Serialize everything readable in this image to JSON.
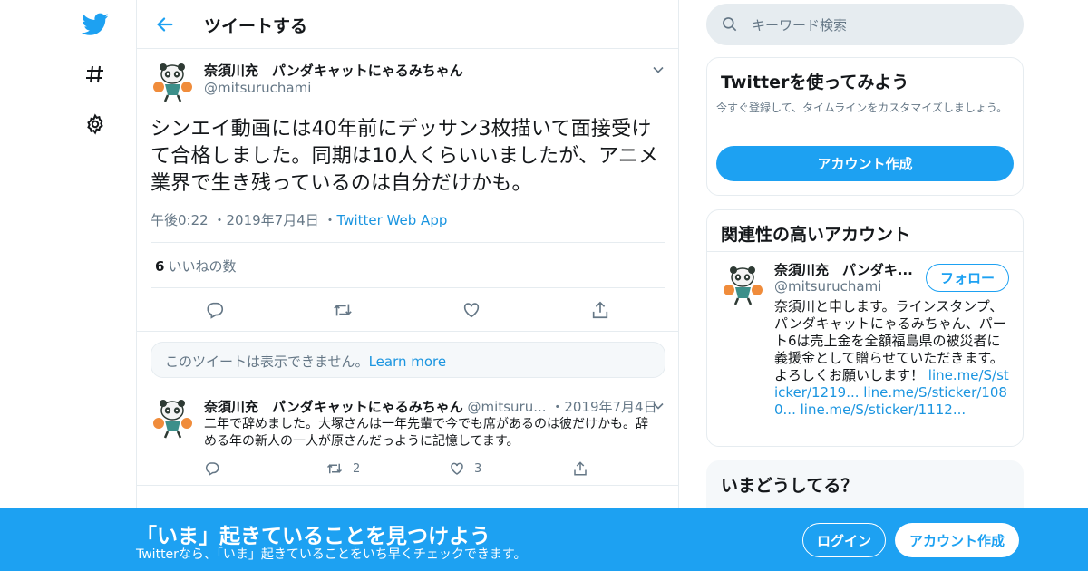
{
  "nav": {
    "icons": [
      "twitter-bird-icon",
      "hashtag-icon",
      "gear-icon"
    ]
  },
  "main": {
    "title": "ツイートする",
    "tweet": {
      "display_name": "奈須川充　パンダキャットにゃるみちゃん",
      "handle": "@mitsuruchami",
      "text": "シンエイ動画には40年前にデッサン3枚描いて面接受けて合格しました。同期は10人くらいいましたが、アニメ業界で生き残っているのは自分だけかも。",
      "time": "午後0:22",
      "date": "2019年7月4日",
      "source": "Twitter Web App",
      "likes_count": "6",
      "likes_label": "いいねの数"
    },
    "unavailable": {
      "text": "このツイートは表示できません。",
      "link": "Learn more"
    },
    "reply": {
      "display_name": "奈須川充　パンダキャットにゃるみちゃん",
      "handle": "@mitsuru...",
      "date": "2019年7月4日",
      "text": "二年で辞めました。大塚さんは一年先輩で今でも席があるのは彼だけかも。辞める年の新人の一人が原さんだっように記憶してます。",
      "retweets": "2",
      "likes": "3"
    }
  },
  "sidebar": {
    "search_placeholder": "キーワード検索",
    "signup": {
      "title": "Twitterを使ってみよう",
      "desc": "今すぐ登録して、タイムラインをカスタマイズしましょう。",
      "button": "アカウント作成"
    },
    "related": {
      "title": "関連性の高いアカウント",
      "name": "奈須川充　パンダキ...",
      "handle": "@mitsuruchami",
      "follow": "フォロー",
      "bio": "奈須川と申します。ラインスタンプ、パンダキャットにゃるみちゃん、パート6は売上金を全額福島県の被災者に義援金として贈らせていただきます。よろしくお願いします！ ",
      "link1": "line.me/S/sticker/1219...",
      "link2": "line.me/S/sticker/1080...",
      "link3": "line.me/S/sticker/1112..."
    },
    "trends": {
      "title": "いまどうしてる？"
    }
  },
  "bottom_bar": {
    "title": "「いま」起きていることを見つけよう",
    "subtitle": "Twitterなら、「いま」起きていることをいち早くチェックできます。",
    "login": "ログイン",
    "signup": "アカウント作成"
  },
  "colors": {
    "accent": "#1da1f2",
    "link": "#1b95e0",
    "muted": "#657786",
    "border": "#e6ecf0"
  }
}
